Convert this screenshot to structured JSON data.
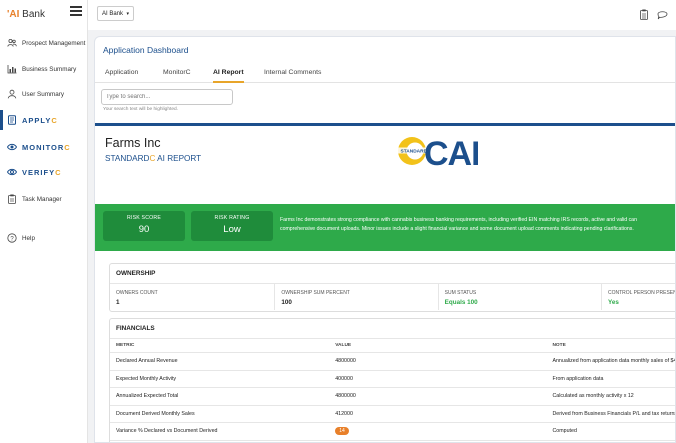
{
  "sidebar": {
    "logo_prefix": "'AI",
    "logo_suffix": " Bank",
    "items": [
      {
        "label": "Prospect Management",
        "icon": "people-icon"
      },
      {
        "label": "Business Summary",
        "icon": "bar-chart-icon"
      },
      {
        "label": "User Summary",
        "icon": "user-icon"
      },
      {
        "label_main": "APPLY",
        "label_accent": "C",
        "icon": "document-icon"
      },
      {
        "label_main": "MONITOR",
        "label_accent": "C",
        "icon": "monitor-eye-icon"
      },
      {
        "label_main": "VERIFY",
        "label_accent": "C",
        "icon": "verify-eye-icon"
      },
      {
        "label": "Task Manager",
        "icon": "clipboard-icon"
      },
      {
        "label": "Help",
        "icon": "help-icon"
      }
    ]
  },
  "topbar": {
    "bank_select": "AI Bank",
    "icons": [
      "clipboard-icon",
      "chat-icon"
    ]
  },
  "page": {
    "title": "Application Dashboard",
    "tabs": [
      {
        "label": "Application",
        "active": false
      },
      {
        "label": "MonitorC",
        "active": false
      },
      {
        "label": "AI Report",
        "active": true
      },
      {
        "label": "Internal Comments",
        "active": false
      }
    ],
    "search_placeholder": "Type to search...",
    "search_hint": "Your search text will be highlighted."
  },
  "report": {
    "company": "Farms Inc",
    "title_main": "STANDARD",
    "title_accent": "C",
    "title_rest": " AI REPORT",
    "logo_small": "STANDARD",
    "logo_big": "CAI",
    "risk_score_label": "RISK SCORE",
    "risk_score_value": "90",
    "risk_rating_label": "RISK RATING",
    "risk_rating_value": "Low",
    "summary_line1": "Farms Inc demonstrates strong compliance with cannabis business banking requirements, including verified EIN matching IRS records, active and valid can",
    "summary_line2": "comprehensive document uploads. Minor issues include a slight financial variance and some document upload comments indicating pending clarifications."
  },
  "ownership": {
    "title": "OWNERSHIP",
    "cells": [
      {
        "label": "OWNERS COUNT",
        "value": "1",
        "green": false
      },
      {
        "label": "OWNERSHIP SUM PERCENT",
        "value": "100",
        "green": false
      },
      {
        "label": "SUM STATUS",
        "value": "Equals 100",
        "green": true
      },
      {
        "label": "CONTROL PERSON PRESEN",
        "value": "Yes",
        "green": true
      }
    ]
  },
  "financials": {
    "title": "FINANCIALS",
    "headers": [
      "METRIC",
      "VALUE",
      "NOTE"
    ],
    "rows": [
      {
        "metric": "Declared Annual Revenue",
        "value": "4800000",
        "note": "Annualized from application data monthly sales of $4"
      },
      {
        "metric": "Expected Monthly Activity",
        "value": "400000",
        "note": "From application data"
      },
      {
        "metric": "Annualized Expected Total",
        "value": "4800000",
        "note": "Calculated as monthly activity x 12"
      },
      {
        "metric": "Document Derived Monthly Sales",
        "value": "412000",
        "note": "Derived from Business Financials P/L and tax returns"
      },
      {
        "metric": "Variance % Declared vs Document Derived",
        "value": "14",
        "note": "Computed",
        "badge": true
      }
    ]
  }
}
